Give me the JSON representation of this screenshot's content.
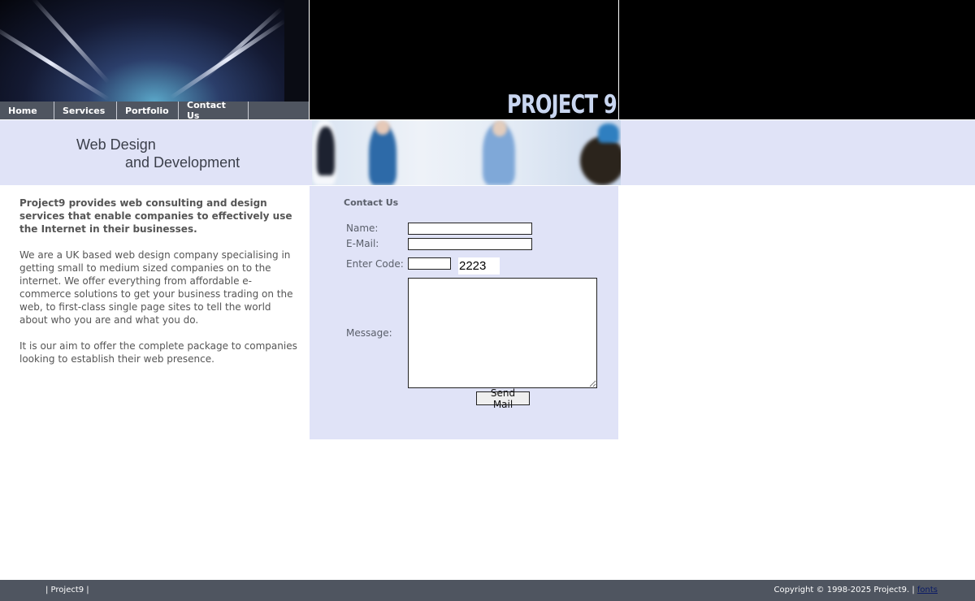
{
  "header": {
    "logo_text": "PROJECT 9",
    "nav": [
      {
        "label": "Home"
      },
      {
        "label": "Services"
      },
      {
        "label": "Portfolio"
      },
      {
        "label": "Contact Us"
      }
    ]
  },
  "tagline": {
    "line1": "Web Design",
    "line2": "and Development"
  },
  "intro": {
    "lead": "Project9 provides web consulting and design services that enable companies to effectively use the Internet in their businesses.",
    "paragraph1": "We are a UK based web design company specialising in getting small to medium sized companies on to the internet. We offer everything from affordable e-commerce solutions to get your business trading on the web, to first-class single page sites to tell the world about who you are and what you do.",
    "paragraph2": "It is our aim to offer the complete package to companies looking to establish their web presence."
  },
  "contact_form": {
    "title": "Contact Us",
    "name_label": "Name:",
    "name_value": "",
    "email_label": "E-Mail:",
    "email_value": "",
    "code_label": "Enter Code:",
    "code_value": "",
    "captcha_code": "2223",
    "message_label": "Message:",
    "message_value": "",
    "submit_label": "Send Mail"
  },
  "footer": {
    "left_text": "| Project9 |",
    "copyright": "Copyright © 1998-2025  Project9. |",
    "fonts_link": "fonts"
  }
}
